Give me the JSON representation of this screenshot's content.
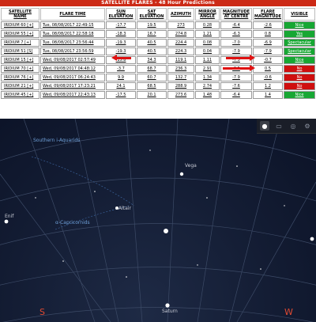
{
  "banner": "SATELLITE FLARES - 48 Hour Predictions",
  "headers": [
    "SATELLITE NAME",
    "FLARE TIME",
    "SUN ELEVATION",
    "SAT ELEVATION",
    "AZIMUTH",
    "MIRROR ANGLE",
    "MAGNITUDE AT CENTRE",
    "FLARE MAGNITUDE",
    "VISIBLE"
  ],
  "rows": [
    {
      "name": "IRIDIUM 60 [+]",
      "time": "Tue, 08/08/2017 22:49:15",
      "sun": "-17.7",
      "sat": "19.5",
      "az": "273",
      "mirror": "0.28",
      "mag_centre": "-6.4",
      "flare_mag": "-2.6",
      "visible": "Nice",
      "vis_color": "green"
    },
    {
      "name": "IRIDIUM 55 [+]",
      "time": "Tue, 08/08/2017 22:58:18",
      "sun": "-18.3",
      "sat": "16.7",
      "az": "274.8",
      "mirror": "1.21",
      "mag_centre": "-6.3",
      "flare_mag": "0.8",
      "visible": "Yes",
      "vis_color": "green"
    },
    {
      "name": "IRIDIUM 7 [+]",
      "time": "Tue, 08/08/2017 23:56:44",
      "sun": "-19.3",
      "sat": "40.5",
      "az": "224.4",
      "mirror": "0.08",
      "mag_centre": "-7.0",
      "flare_mag": "-6.9",
      "visible": "Spectacular",
      "vis_color": "green"
    },
    {
      "name": "IRIDIUM 51 [S]",
      "time": "Tue, 08/08/2017 23:56:59",
      "sun": "-19.3",
      "sat": "40.5",
      "az": "224.3",
      "mirror": "0.04",
      "mag_centre": "-7.9",
      "flare_mag": "-7.9",
      "visible": "Spectacular",
      "vis_color": "green"
    },
    {
      "name": "IRIDIUM 15 [+]",
      "time": "Wed, 09/08/2017 02:57:49",
      "sun": "-15.8",
      "sat": "34.3",
      "az": "119.1",
      "mirror": "1.11",
      "mag_centre": "-7.5",
      "flare_mag": "-0.7",
      "visible": "Nice",
      "vis_color": "green"
    },
    {
      "name": "IRIDIUM 70 [+]",
      "time": "Wed, 09/08/2017 04:48:12",
      "sun": "-3.7",
      "sat": "68.7",
      "az": "236.3",
      "mirror": "2.91",
      "mag_centre": "-8.5",
      "flare_mag": "0.5",
      "visible": "No",
      "vis_color": "red"
    },
    {
      "name": "IRIDIUM 76 [+]",
      "time": "Wed, 09/08/2017 06:24:43",
      "sun": "9.9",
      "sat": "60.7",
      "az": "132.7",
      "mirror": "1.34",
      "mag_centre": "-7.9",
      "flare_mag": "-0.6",
      "visible": "No",
      "vis_color": "red"
    },
    {
      "name": "IRIDIUM 21 [+]",
      "time": "Wed, 09/08/2017 17:23:21",
      "sun": "24.1",
      "sat": "68.5",
      "az": "288.9",
      "mirror": "2.74",
      "mag_centre": "-7.6",
      "flare_mag": "1.2",
      "visible": "No",
      "vis_color": "red"
    },
    {
      "name": "IRIDIUM 45 [+]",
      "time": "Wed, 09/08/2017 22:43:13",
      "sun": "-17.5",
      "sat": "20.1",
      "az": "273.6",
      "mirror": "1.48",
      "mag_centre": "-6.4",
      "flare_mag": "1.4",
      "visible": "Nice",
      "vis_color": "green"
    }
  ],
  "sky": {
    "labels": {
      "southern_aquarids": "Southern i-Aquarids",
      "alpha_capricornids": "α-Capricornids",
      "vega": "Vega",
      "altair": "Altair",
      "enif": "Enif",
      "saturn": "Saturn"
    },
    "compass": {
      "south": "S",
      "west": "W"
    }
  }
}
